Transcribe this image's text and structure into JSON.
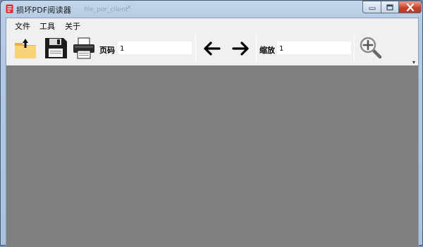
{
  "window": {
    "title": "损坏PDF阅读器",
    "background_tab_text": "file_por_client",
    "background_tab_close": "×"
  },
  "controls": {
    "minimize": "minimize-icon",
    "maximize": "maximize-icon",
    "close": "close-icon"
  },
  "menu": {
    "file": "文件",
    "tools": "工具",
    "about": "关于"
  },
  "toolbar": {
    "open_icon": "folder-open-icon",
    "save_icon": "floppy-save-icon",
    "print_icon": "printer-icon",
    "page_label": "页码",
    "page_value": "1",
    "prev_icon": "arrow-left-icon",
    "next_icon": "arrow-right-icon",
    "zoom_label": "缩放",
    "zoom_value": "1",
    "zoom_icon": "zoom-in-icon",
    "overflow": "▾"
  },
  "colors": {
    "viewer_bg": "#7f7f7f",
    "toolbar_bg": "#f0f0f0",
    "close_red": "#c8442d"
  }
}
